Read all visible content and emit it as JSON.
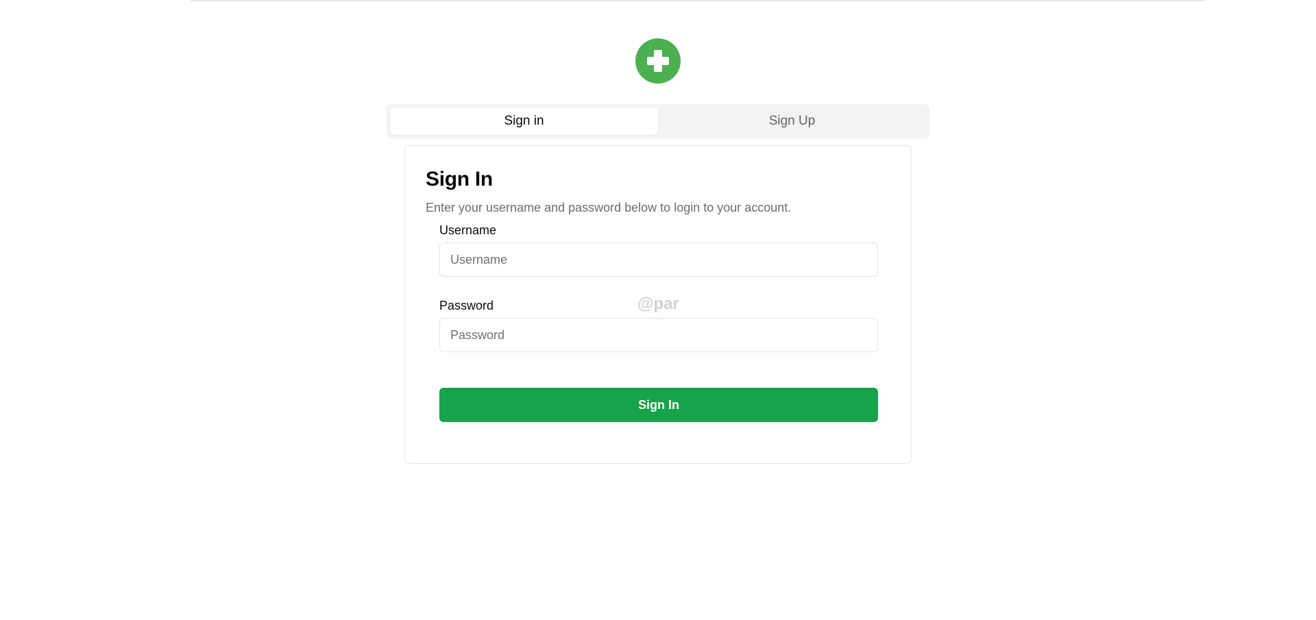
{
  "colors": {
    "accent": "#4caf50",
    "button": "#16a34a",
    "tab_bg": "#f3f3f3",
    "border": "#e4e4e7",
    "muted_text": "#6b6b73"
  },
  "logo": {
    "icon": "plus-circle-icon"
  },
  "tabs": [
    {
      "label": "Sign in",
      "active": true
    },
    {
      "label": "Sign Up",
      "active": false
    }
  ],
  "card": {
    "title": "Sign In",
    "description": "Enter your username and password below to login to your account.",
    "username": {
      "label": "Username",
      "placeholder": "Username",
      "value": ""
    },
    "password": {
      "label": "Password",
      "placeholder": "Password",
      "value": ""
    },
    "submit_label": "Sign In"
  },
  "watermark": "@par"
}
